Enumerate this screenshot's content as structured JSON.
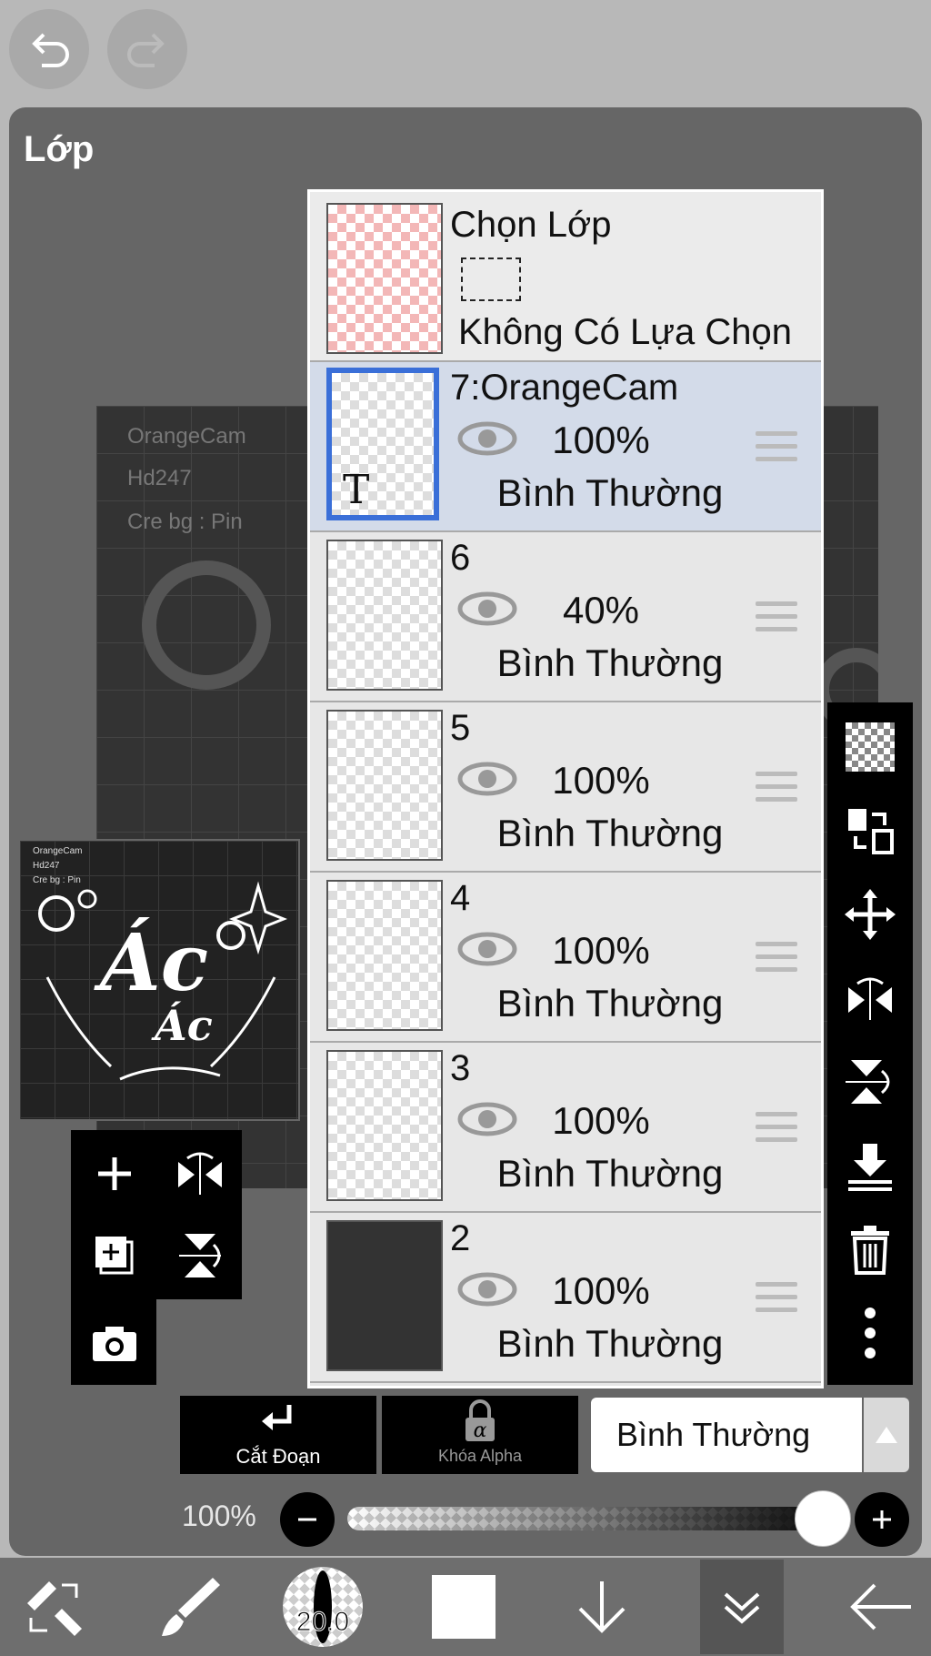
{
  "panel": {
    "title": "Lớp"
  },
  "canvas_text": [
    "OrangeCam",
    "Hd247",
    "Cre bg : Pin"
  ],
  "preview": {
    "text": [
      "OrangeCam",
      "Hd247",
      "Cre bg : Pin"
    ],
    "title_big": "Ác",
    "title_small": "Ác"
  },
  "selection_layer": {
    "title": "Chọn Lớp",
    "status": "Không Có Lựa Chọn"
  },
  "layers": [
    {
      "name": "7:OrangeCam",
      "opacity": "100%",
      "mode": "Bình Thường",
      "active": true,
      "thumb": "text",
      "thumb_label": "T"
    },
    {
      "name": "6",
      "opacity": "40%",
      "mode": "Bình Thường",
      "active": false,
      "thumb": "checker"
    },
    {
      "name": "5",
      "opacity": "100%",
      "mode": "Bình Thường",
      "active": false,
      "thumb": "checker"
    },
    {
      "name": "4",
      "opacity": "100%",
      "mode": "Bình Thường",
      "active": false,
      "thumb": "checker"
    },
    {
      "name": "3",
      "opacity": "100%",
      "mode": "Bình Thường",
      "active": false,
      "thumb": "checker"
    },
    {
      "name": "2",
      "opacity": "100%",
      "mode": "Bình Thường",
      "active": false,
      "thumb": "photo"
    }
  ],
  "actions": {
    "clip_label": "Cắt Đoạn",
    "alpha_lock_label": "Khóa Alpha",
    "blend_mode": "Bình Thường"
  },
  "opacity_slider": {
    "label": "100%",
    "value": 1.0
  },
  "brush_size": "20.0",
  "colors": {
    "panel": "#666666",
    "active_layer": "#d3dbe9",
    "active_border": "#3a6fd8",
    "toolbar": "#000000"
  }
}
